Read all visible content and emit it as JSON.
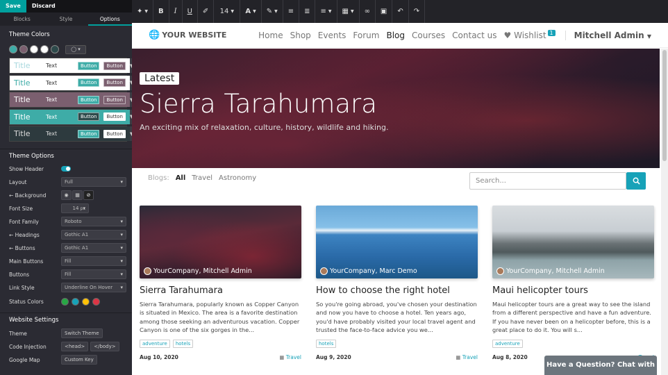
{
  "editor": {
    "save_label": "Save",
    "discard_label": "Discard",
    "tabs": [
      "Blocks",
      "Style",
      "Options"
    ],
    "theme_colors_title": "Theme Colors",
    "swatch_colors": [
      "#3eaca7",
      "#7b5f6f",
      "#ffffff",
      "#ffffff",
      "#2d4a4b"
    ],
    "palettes": [
      {
        "title": "Title",
        "text": "Text",
        "b1": "Button",
        "b2": "Button",
        "bg": "#ffffff",
        "fg": "#333333",
        "tc": "#a8d8de",
        "b1bg": "#3eaca7",
        "b2bg": "#7b5f6f"
      },
      {
        "title": "Title",
        "text": "Text",
        "b1": "Button",
        "b2": "Button",
        "bg": "#ffffff",
        "fg": "#333333",
        "tc": "#3eaca7",
        "b1bg": "#3eaca7",
        "b2bg": "#7b5f6f"
      },
      {
        "title": "Title",
        "text": "Text",
        "b1": "Button",
        "b2": "Button",
        "bg": "#7b5f6f",
        "fg": "#ffffff",
        "tc": "#ffffff",
        "b1bg": "#3eaca7",
        "b2bg": "#7b5f6f"
      },
      {
        "title": "Title",
        "text": "Text",
        "b1": "Button",
        "b2": "Button",
        "bg": "#3eaca7",
        "fg": "#ffffff",
        "tc": "#ffffff",
        "b1bg": "#2d4a4b",
        "b2bg": "#ffffff"
      },
      {
        "title": "Title",
        "text": "Text",
        "b1": "Button",
        "b2": "Button",
        "bg": "#2d3a3e",
        "fg": "#dddddd",
        "tc": "#dddddd",
        "b1bg": "#3eaca7",
        "b2bg": "#ffffff"
      }
    ],
    "theme_options_title": "Theme Options",
    "options": {
      "show_header": "Show Header",
      "layout": "Layout",
      "layout_val": "Full",
      "background": "← Background",
      "font_size": "Font Size",
      "font_size_val": "14",
      "font_size_unit": "px",
      "font_family": "Font Family",
      "font_family_val": "Roboto",
      "headings": "← Headings",
      "headings_val": "Gothic A1",
      "buttons_font": "← Buttons",
      "buttons_font_val": "Gothic A1",
      "main_buttons": "Main Buttons",
      "main_buttons_val": "Fill",
      "buttons": "Buttons",
      "buttons_val": "Fill",
      "link_style": "Link Style",
      "link_style_val": "Underline On Hover",
      "status_colors": "Status Colors",
      "status_palette": [
        "#28a745",
        "#17a2b8",
        "#ffc107",
        "#dc3545"
      ]
    },
    "website_settings_title": "Website Settings",
    "settings": {
      "theme": "Theme",
      "theme_btn": "Switch Theme",
      "code_injection": "Code Injection",
      "head_btn": "<head>",
      "body_btn": "</body>",
      "google_map": "Google Map",
      "map_btn": "Custom Key"
    }
  },
  "toolbar": {
    "font_size": "14"
  },
  "site": {
    "logo": "YOUR WEBSITE",
    "menu": [
      "Home",
      "Shop",
      "Events",
      "Forum",
      "Blog",
      "Courses",
      "Contact us"
    ],
    "active_menu": "Blog",
    "wishlist": "Wishlist",
    "wishlist_count": "1",
    "user": "Mitchell Admin",
    "hero": {
      "badge": "Latest",
      "title": "Sierra Tarahumara",
      "subtitle": "An exciting mix of relaxation, culture, history, wildlife and hiking."
    },
    "filters": {
      "label": "Blogs:",
      "items": [
        "All",
        "Travel",
        "Astronomy"
      ]
    },
    "search_placeholder": "Search...",
    "cards": [
      {
        "author": "YourCompany, Mitchell Admin",
        "title": "Sierra Tarahumara",
        "desc": "Sierra Tarahumara, popularly known as Copper Canyon is situated in Mexico. The area is a favorite destination among those seeking an adventurous vacation. Copper Canyon is one of the six gorges in the...",
        "tags": [
          "adventure",
          "hotels"
        ],
        "date": "Aug 10, 2020",
        "category": "Travel"
      },
      {
        "author": "YourCompany, Marc Demo",
        "title": "How to choose the right hotel",
        "desc": "So you're going abroad, you've chosen your destination and now you have to choose a hotel. Ten years ago, you'd have probably visited your local travel agent and trusted the face-to-face advice you we...",
        "tags": [
          "hotels"
        ],
        "date": "Aug 9, 2020",
        "category": "Travel"
      },
      {
        "author": "YourCompany, Mitchell Admin",
        "title": "Maui helicopter tours",
        "desc": "Maui helicopter tours are a great way to see the island from a different perspective and have a fun adventure. If you have never been on a helicopter before, this is a great place to do it. You will s...",
        "tags": [
          "adventure"
        ],
        "date": "Aug 8, 2020",
        "category": "Travel"
      }
    ],
    "chat": "Have a Question? Chat with us."
  }
}
